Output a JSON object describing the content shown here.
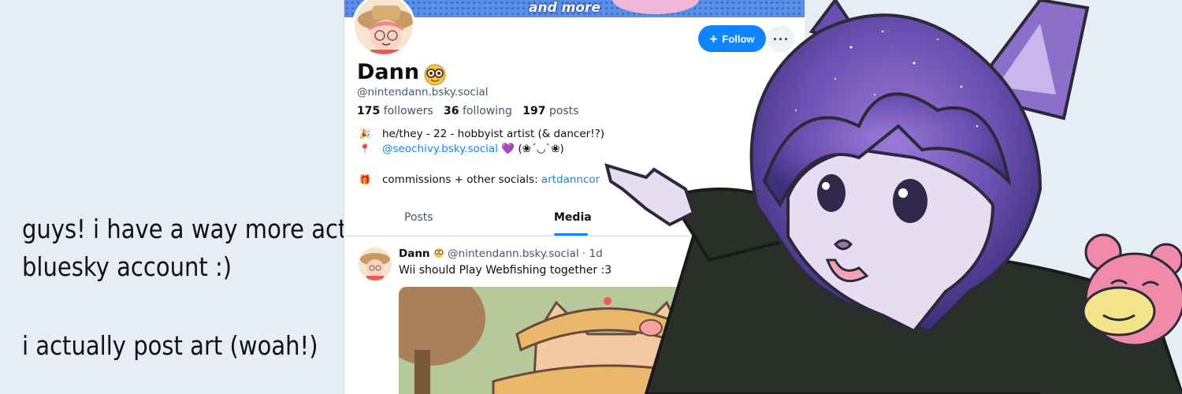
{
  "caption": {
    "line1": "guys! i have a way more active",
    "line2": "bluesky account :)",
    "line3": "i actually post art (woah!)"
  },
  "banner": {
    "text": "and more"
  },
  "profile": {
    "display_name": "Dann",
    "handle": "@nintendann.bsky.social",
    "followers_count": "175",
    "followers_label": "followers",
    "following_count": "36",
    "following_label": "following",
    "posts_count": "197",
    "posts_label": "posts",
    "follow_label": "Follow",
    "more_label": "···",
    "bio": {
      "line1_icon": "🎉",
      "line1_text": "he/they - 22 - hobbyist artist (& dancer!?)",
      "line2_icon": "📍",
      "line2_link": "@seochivy.bsky.social",
      "line2_suffix": "💜 (❀´◡`❀)",
      "line3_icon": "🎁",
      "line3_text": "commissions + other socials: ",
      "line3_link": "artdanncor"
    }
  },
  "tabs": {
    "posts": "Posts",
    "media": "Media"
  },
  "post": {
    "author": "Dann",
    "handle": "@nintendann.bsky.social",
    "time": "· 1d",
    "text": "Wii should Play Webfishing together :3"
  },
  "colors": {
    "page_bg": "#e6edf7",
    "accent": "#1083fe",
    "fur_purple": "#6a4fb0",
    "fur_light": "#e7ddf3",
    "sweater": "#2b2f2a"
  },
  "icons": {
    "nerd_face": "nerd-face-icon",
    "plus": "plus-icon",
    "more": "ellipsis-icon"
  }
}
